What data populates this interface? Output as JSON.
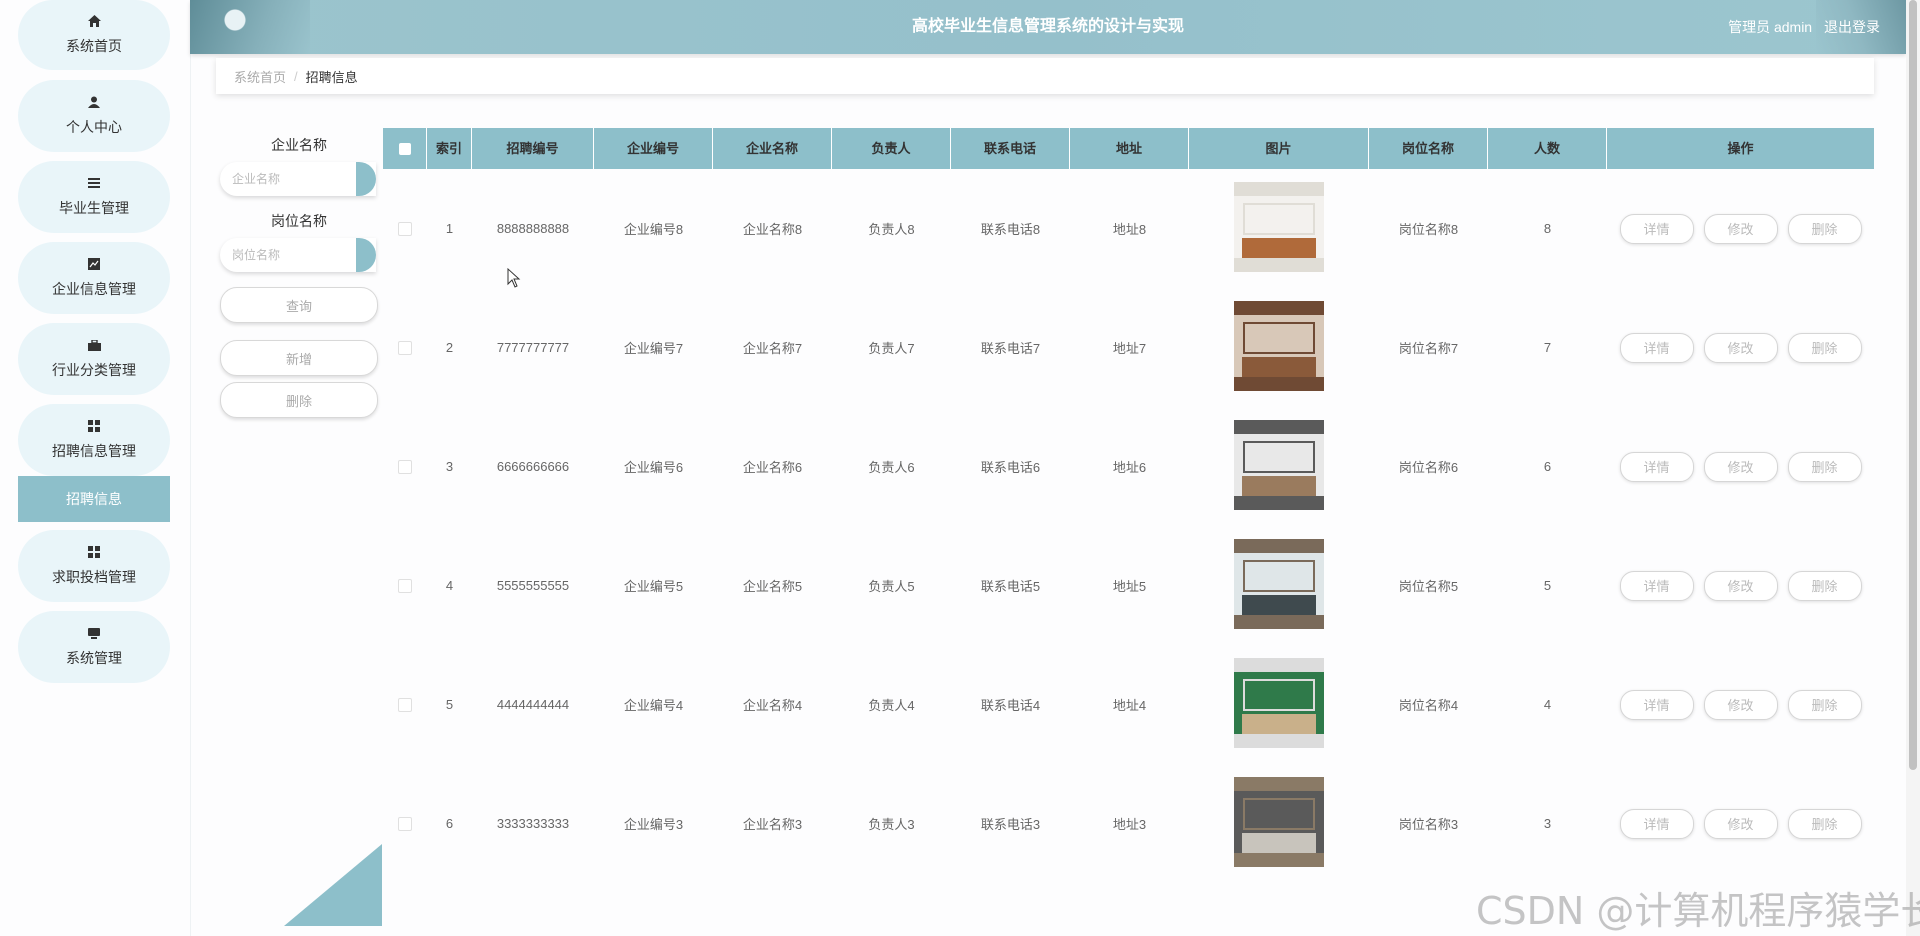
{
  "header": {
    "title": "高校毕业生信息管理系统的设计与实现",
    "user_label": "管理员 admin",
    "logout_label": "退出登录"
  },
  "sidebar": {
    "items": [
      {
        "label": "系统首页",
        "icon": "home-icon"
      },
      {
        "label": "个人中心",
        "icon": "user-icon"
      },
      {
        "label": "毕业生管理",
        "icon": "list-icon"
      },
      {
        "label": "企业信息管理",
        "icon": "chart-icon"
      },
      {
        "label": "行业分类管理",
        "icon": "briefcase-icon"
      },
      {
        "label": "招聘信息管理",
        "icon": "grid-icon"
      },
      {
        "label": "求职投档管理",
        "icon": "grid-icon"
      },
      {
        "label": "系统管理",
        "icon": "monitor-icon"
      }
    ],
    "active_sub": "招聘信息"
  },
  "breadcrumb": {
    "home": "系统首页",
    "sep": "/",
    "current": "招聘信息"
  },
  "search": {
    "company_label": "企业名称",
    "company_placeholder": "企业名称",
    "position_label": "岗位名称",
    "position_placeholder": "岗位名称",
    "query_button": "查询",
    "add_button": "新增",
    "delete_button": "删除"
  },
  "table": {
    "columns": [
      "索引",
      "招聘编号",
      "企业编号",
      "企业名称",
      "负责人",
      "联系电话",
      "地址",
      "图片",
      "岗位名称",
      "人数",
      "操作"
    ],
    "rows": [
      {
        "index": "1",
        "code": "8888888888",
        "company_no": "企业编号8",
        "company_name": "企业名称8",
        "contact": "负责人8",
        "phone": "联系电话8",
        "address": "地址8",
        "position": "岗位名称8",
        "count": "8",
        "image": "office-lobby"
      },
      {
        "index": "2",
        "code": "7777777777",
        "company_no": "企业编号7",
        "company_name": "企业名称7",
        "contact": "负责人7",
        "phone": "联系电话7",
        "address": "地址7",
        "position": "岗位名称7",
        "count": "7",
        "image": "office-desk"
      },
      {
        "index": "3",
        "code": "6666666666",
        "company_no": "企业编号6",
        "company_name": "企业名称6",
        "contact": "负责人6",
        "phone": "联系电话6",
        "address": "地址6",
        "position": "岗位名称6",
        "count": "6",
        "image": "open-office"
      },
      {
        "index": "4",
        "code": "5555555555",
        "company_no": "企业编号5",
        "company_name": "企业名称5",
        "contact": "负责人5",
        "phone": "联系电话5",
        "address": "地址5",
        "position": "岗位名称5",
        "count": "5",
        "image": "manager-office"
      },
      {
        "index": "5",
        "code": "4444444444",
        "company_no": "企业编号4",
        "company_name": "企业名称4",
        "contact": "负责人4",
        "phone": "联系电话4",
        "address": "地址4",
        "position": "岗位名称4",
        "count": "4",
        "image": "green-office"
      },
      {
        "index": "6",
        "code": "3333333333",
        "company_no": "企业编号3",
        "company_name": "企业名称3",
        "contact": "负责人3",
        "phone": "联系电话3",
        "address": "地址3",
        "position": "岗位名称3",
        "count": "3",
        "image": "meeting-room"
      }
    ],
    "actions": {
      "detail": "详情",
      "edit": "修改",
      "delete": "删除"
    }
  },
  "watermark": "CSDN @计算机程序猿学长",
  "colors": {
    "accent": "#8dbfca",
    "nav_bg": "#e9f5f9"
  }
}
